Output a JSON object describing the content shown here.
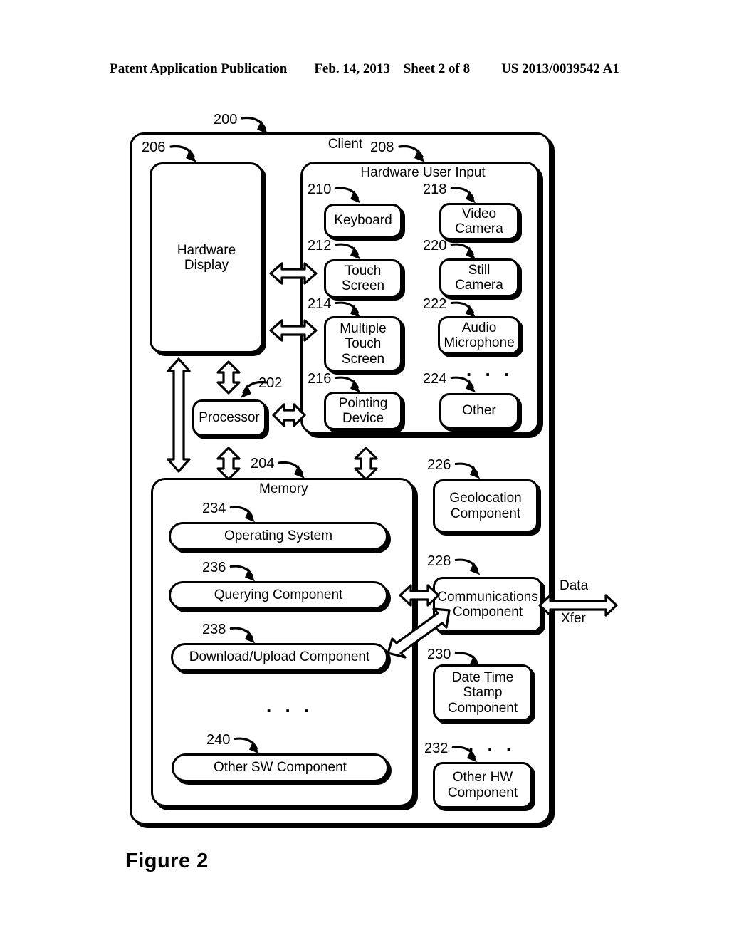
{
  "header": {
    "left": "Patent Application Publication",
    "date": "Feb. 14, 2013",
    "sheet": "Sheet 2 of 8",
    "patent_number": "US 2013/0039542 A1"
  },
  "figure": {
    "caption": "Figure 2"
  },
  "client": {
    "ref": "200",
    "title": "Client"
  },
  "hardware_display": {
    "ref": "206",
    "label": "Hardware\nDisplay",
    "line1": "Hardware",
    "line2": "Display"
  },
  "hardware_user_input": {
    "ref": "208",
    "title": "Hardware User Input",
    "left_column": [
      {
        "ref": "210",
        "label": "Keyboard",
        "lines": [
          "Keyboard"
        ]
      },
      {
        "ref": "212",
        "label": "Touch Screen",
        "lines": [
          "Touch",
          "Screen"
        ]
      },
      {
        "ref": "214",
        "label": "Multiple Touch Screen",
        "lines": [
          "Multiple",
          "Touch",
          "Screen"
        ]
      },
      {
        "ref": "216",
        "label": "Pointing Device",
        "lines": [
          "Pointing",
          "Device"
        ]
      }
    ],
    "right_column": [
      {
        "ref": "218",
        "label": "Video Camera",
        "lines": [
          "Video",
          "Camera"
        ]
      },
      {
        "ref": "220",
        "label": "Still Camera",
        "lines": [
          "Still",
          "Camera"
        ]
      },
      {
        "ref": "222",
        "label": "Audio Microphone",
        "lines": [
          "Audio",
          "Microphone"
        ]
      },
      {
        "ref": "224",
        "label": "Other",
        "lines": [
          "Other"
        ]
      }
    ],
    "right_column_ellipsis": ". . ."
  },
  "processor": {
    "ref": "202",
    "label": "Processor"
  },
  "memory": {
    "ref": "204",
    "title": "Memory",
    "components": [
      {
        "ref": "234",
        "label": "Operating System"
      },
      {
        "ref": "236",
        "label": "Querying Component"
      },
      {
        "ref": "238",
        "label": "Download/Upload Component"
      },
      {
        "ref": "240",
        "label": "Other  SW Component"
      }
    ],
    "ellipsis": ". . ."
  },
  "hardware_components": [
    {
      "ref": "226",
      "label": "Geolocation Component",
      "lines": [
        "Geolocation",
        "Component"
      ]
    },
    {
      "ref": "228",
      "label": "Communications Component",
      "lines": [
        "Communications",
        "Component"
      ]
    },
    {
      "ref": "230",
      "label": "Date Time Stamp Component",
      "lines": [
        "Date Time",
        "Stamp",
        "Component"
      ]
    },
    {
      "ref": "232",
      "label": "Other HW Component",
      "lines": [
        "Other HW",
        "Component"
      ]
    }
  ],
  "hardware_components_ellipsis": ". . .",
  "data_transfer": {
    "top_label": "Data",
    "bottom_label": "Xfer"
  },
  "colors": {
    "ink": "#000000",
    "paper": "#ffffff"
  }
}
